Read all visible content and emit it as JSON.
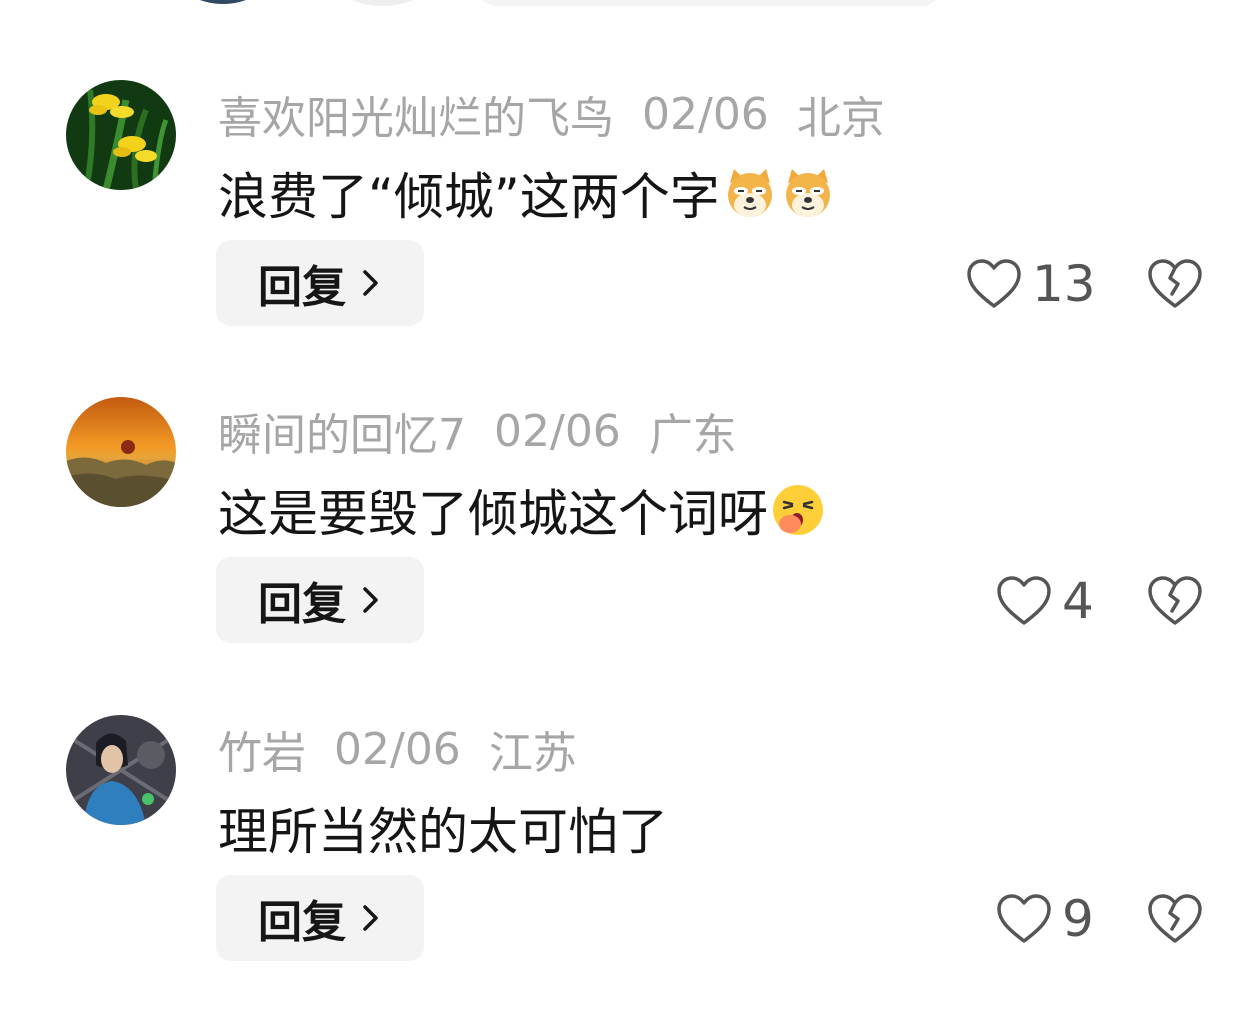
{
  "comments": [
    {
      "username": "喜欢阳光灿烂的飞鸟",
      "date": "02/06",
      "location": "北京",
      "text": "浪费了“倾城”这两个字",
      "emoji_icons": [
        "doge-icon",
        "doge-icon"
      ],
      "reply_label": "回复",
      "likes": "13"
    },
    {
      "username": "瞬间的回忆7",
      "date": "02/06",
      "location": "广东",
      "text": "这是要毁了倾城这个词呀",
      "emoji_icons": [
        "yawn-icon"
      ],
      "reply_label": "回复",
      "likes": "4"
    },
    {
      "username": "竹岩",
      "date": "02/06",
      "location": "江苏",
      "text": "理所当然的太可怕了",
      "emoji_icons": [],
      "reply_label": "回复",
      "likes": "9"
    }
  ],
  "colors": {
    "meta_text": "#a6a6a6",
    "body_text": "#151515",
    "button_bg": "#f3f3f3",
    "icon_stroke": "#555555"
  }
}
